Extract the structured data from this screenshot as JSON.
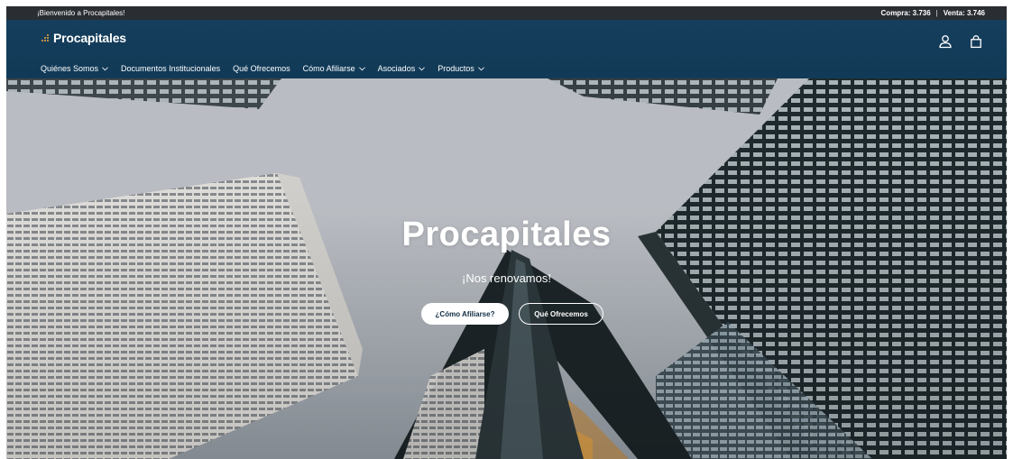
{
  "topbar": {
    "welcome": "¡Bienvenido a Procapitales!",
    "compra": "Compra: 3.736",
    "separator": "|",
    "venta": "Venta: 3.746"
  },
  "header": {
    "logo_text": "Procapitales",
    "icons": [
      "account-icon",
      "cart-icon"
    ]
  },
  "nav": {
    "items": [
      {
        "label": "Quiénes Somos",
        "dropdown": true
      },
      {
        "label": "Documentos Institucionales",
        "dropdown": false
      },
      {
        "label": "Qué Ofrecemos",
        "dropdown": false
      },
      {
        "label": "Cómo Afiliarse",
        "dropdown": true
      },
      {
        "label": "Asociados",
        "dropdown": true
      },
      {
        "label": "Productos",
        "dropdown": true
      }
    ]
  },
  "hero": {
    "title": "Procapitales",
    "subtitle": "¡Nos renovamos!",
    "primary_button": "¿Cómo Afiliarse?",
    "secondary_button": "Qué Ofrecemos"
  },
  "colors": {
    "topbar": "#2a2d32",
    "header": "#153e5c",
    "logo_accent": "#f0a83c"
  }
}
